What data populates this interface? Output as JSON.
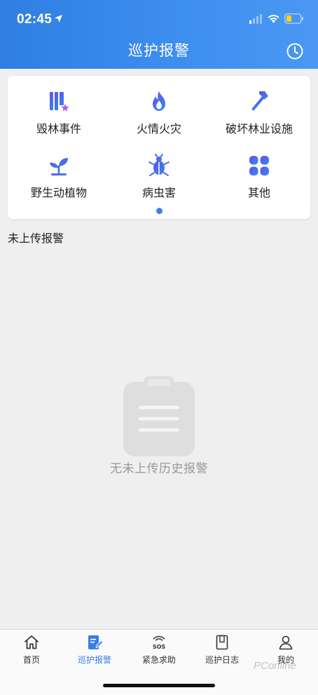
{
  "status_bar": {
    "time": "02:45"
  },
  "header": {
    "title": "巡护报警"
  },
  "categories": [
    {
      "label": "毁林事件"
    },
    {
      "label": "火情火灾"
    },
    {
      "label": "破坏林业设施"
    },
    {
      "label": "野生动植物"
    },
    {
      "label": "病虫害"
    },
    {
      "label": "其他"
    }
  ],
  "section": {
    "title": "未上传报警"
  },
  "empty_state": {
    "text": "无未上传历史报警"
  },
  "tabs": [
    {
      "label": "首页",
      "active": false
    },
    {
      "label": "巡护报警",
      "active": true
    },
    {
      "label": "紧急求助",
      "active": false
    },
    {
      "label": "巡护日志",
      "active": false
    },
    {
      "label": "我的",
      "active": false
    }
  ],
  "sos_icon_text": "SOS",
  "watermark": "PConline",
  "colors": {
    "accent": "#3b7de6",
    "header_start": "#2f7ee3",
    "header_end": "#4a98f3",
    "icon_gradient_start": "#5b4ee6",
    "icon_gradient_end": "#2f8cf0"
  }
}
